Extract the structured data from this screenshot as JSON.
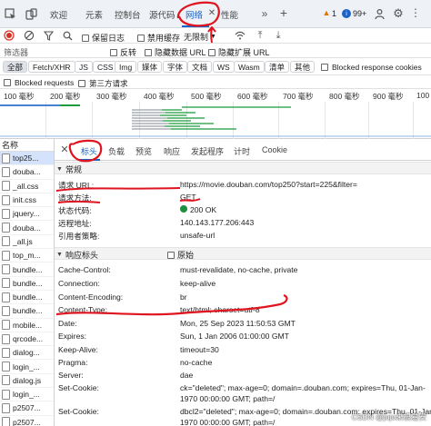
{
  "tabs": {
    "items": [
      "欢迎",
      "元素",
      "控制台",
      "源代码",
      "网络",
      "性能"
    ],
    "active_index": 4,
    "warnings": "1",
    "messages": "99+"
  },
  "toolbar": {
    "preserve_log": "保留日志",
    "disable_cache": "禁用缓存",
    "throttle": "无限制"
  },
  "filter": {
    "placeholder": "筛选器",
    "invert": "反转",
    "hide_data_urls": "隐藏数据 URL",
    "hide_ext_urls": "隐藏扩展 URL"
  },
  "types": [
    "全部",
    "Fetch/XHR",
    "JS",
    "CSS",
    "Img",
    "媒体",
    "字体",
    "文档",
    "WS",
    "Wasm",
    "清单",
    "其他"
  ],
  "blocked_response_cookies": "Blocked response cookies",
  "blocked_requests": "Blocked requests",
  "third_party": "第三方请求",
  "timeline": {
    "ticks": [
      "100 毫秒",
      "200 毫秒",
      "300 毫秒",
      "400 毫秒",
      "500 毫秒",
      "600 毫秒",
      "700 毫秒",
      "800 毫秒",
      "900 毫秒",
      "100"
    ]
  },
  "request_list": {
    "header": "名称",
    "items": [
      "top25...",
      "douba...",
      "_all.css",
      "init.css",
      "jquery...",
      "douba...",
      "_all.js",
      "top_m...",
      "bundle...",
      "bundle...",
      "bundle...",
      "bundle...",
      "mobile...",
      "qrcode...",
      "dialog...",
      "login_...",
      "dialog.js",
      "login_...",
      "p2507...",
      "p2507..."
    ],
    "selected_index": 0
  },
  "detail": {
    "tabs": [
      "标头",
      "负载",
      "预览",
      "响应",
      "发起程序",
      "计时",
      "Cookie"
    ],
    "active_tab": 0,
    "general_title": "常规",
    "general": [
      {
        "k": "请求 URL:",
        "v": "https://movie.douban.com/top250?start=225&filter="
      },
      {
        "k": "请求方法:",
        "v": "GET"
      },
      {
        "k": "状态代码:",
        "v": "200 OK"
      },
      {
        "k": "远程地址:",
        "v": "140.143.177.206:443"
      },
      {
        "k": "引用者策略:",
        "v": "unsafe-url"
      }
    ],
    "response_title": "响应标头",
    "raw_label": "原始",
    "response": [
      {
        "k": "Cache-Control:",
        "v": "must-revalidate, no-cache, private"
      },
      {
        "k": "Connection:",
        "v": "keep-alive"
      },
      {
        "k": "Content-Encoding:",
        "v": "br"
      },
      {
        "k": "Content-Type:",
        "v": "text/html; charset=utf-8"
      },
      {
        "k": "Date:",
        "v": "Mon, 25 Sep 2023 11:50:53 GMT"
      },
      {
        "k": "Expires:",
        "v": "Sun, 1 Jan 2006 01:00:00 GMT"
      },
      {
        "k": "Keep-Alive:",
        "v": "timeout=30"
      },
      {
        "k": "Pragma:",
        "v": "no-cache"
      },
      {
        "k": "Server:",
        "v": "dae"
      },
      {
        "k": "Set-Cookie:",
        "v": "ck=\"deleted\"; max-age=0; domain=.douban.com; expires=Thu, 01-Jan-",
        "v2": "1970 00:00:00 GMT; path=/"
      },
      {
        "k": "Set-Cookie:",
        "v": "dbcl2=\"deleted\"; max-age=0; domain=.douban.com; expires=Thu, 01-Jan-",
        "v2": "1970 00:00:00 GMT; path=/"
      }
    ]
  },
  "watermark": "CSDN @jojo来根易安",
  "colors": {
    "accent": "#1a63c7",
    "annotation": "#e0141e",
    "status_ok": "#1e8e3e"
  }
}
